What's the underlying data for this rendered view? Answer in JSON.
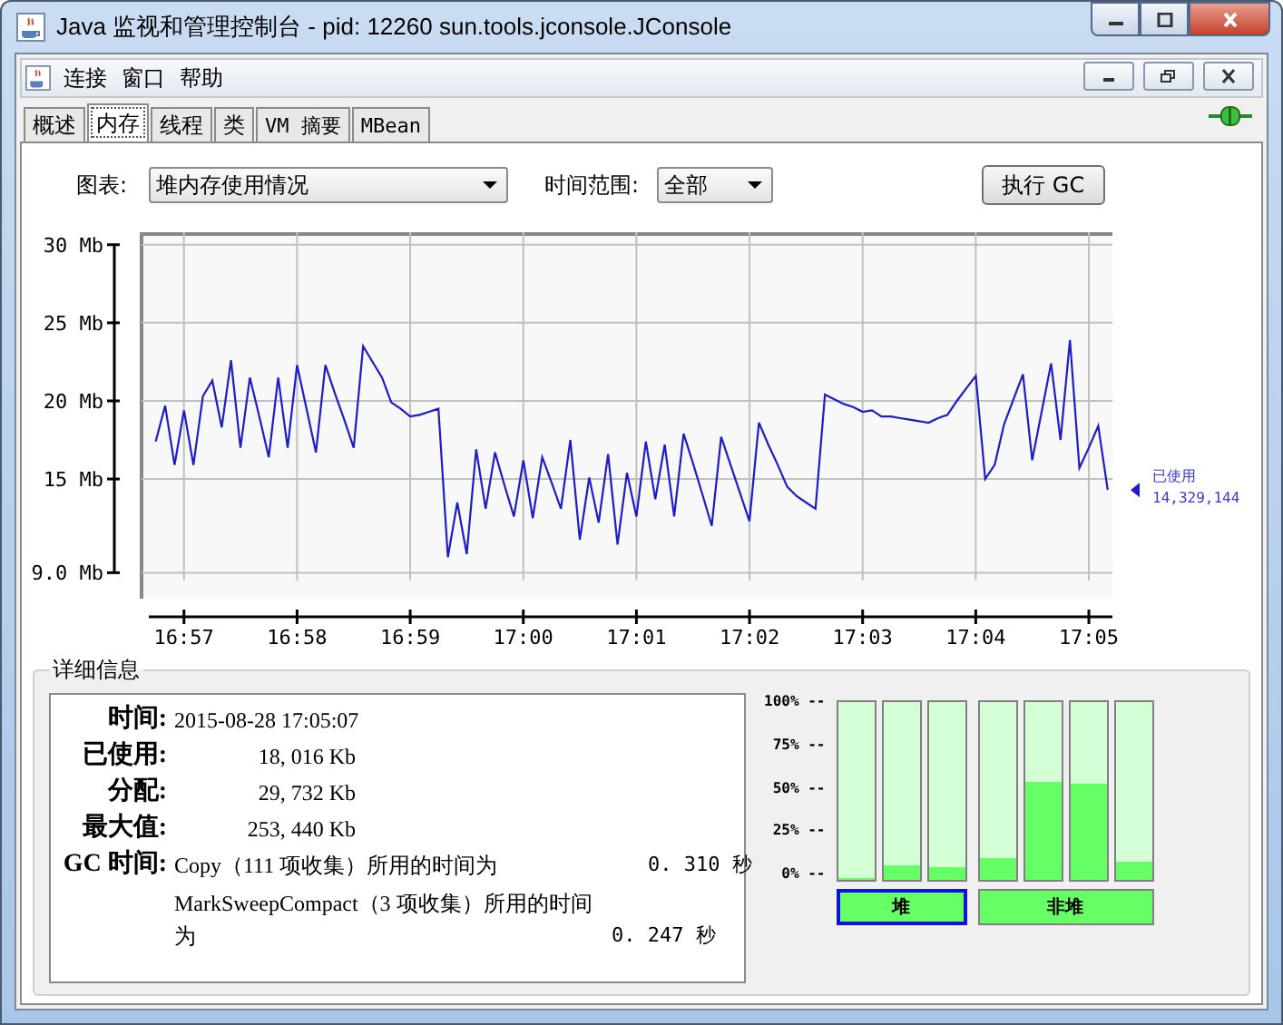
{
  "window": {
    "title": "Java 监视和管理控制台 - pid: 12260 sun.tools.jconsole.JConsole"
  },
  "menu": [
    "连接",
    "窗口",
    "帮助"
  ],
  "tabs": [
    {
      "label": "概述",
      "selected": false
    },
    {
      "label": "内存",
      "selected": true
    },
    {
      "label": "线程",
      "selected": false
    },
    {
      "label": "类",
      "selected": false
    },
    {
      "label": "VM 摘要",
      "selected": false
    },
    {
      "label": "MBean",
      "selected": false
    }
  ],
  "controls": {
    "chart_label": "图表:",
    "chart_select": "堆内存使用情况",
    "range_label": "时间范围:",
    "range_select": "全部",
    "gc_button": "执行 GC"
  },
  "chart": {
    "legend": {
      "value": "14,329,144"
    },
    "chart_data": {
      "type": "line",
      "categories": [
        null,
        null,
        null,
        null,
        "16:57",
        null,
        null,
        null,
        null,
        null,
        null,
        null,
        null,
        null,
        null,
        null,
        "16:58",
        null,
        null,
        null,
        null,
        null,
        null,
        null,
        null,
        null,
        null,
        null,
        "16:59",
        null,
        null,
        null,
        null,
        null,
        null,
        null,
        null,
        null,
        null,
        null,
        "17:00",
        null,
        null,
        null,
        null,
        null,
        null,
        null,
        null,
        null,
        null,
        null,
        "17:01",
        null,
        null,
        null,
        null,
        null,
        null,
        null,
        null,
        null,
        null,
        null,
        "17:02",
        null,
        null,
        null,
        null,
        null,
        null,
        null,
        null,
        null,
        null,
        null,
        "17:03",
        null,
        null,
        null,
        null,
        null,
        null,
        null,
        null,
        null,
        null,
        null,
        "17:04",
        null,
        null,
        null,
        null,
        null,
        null,
        null,
        null,
        null,
        null,
        null,
        "17:05",
        null,
        null
      ],
      "series": [
        {
          "name": "已使用",
          "color": "#1c1cc8",
          "values": [
            null,
            17.4,
            19.7,
            15.9,
            19.4,
            15.9,
            20.3,
            21.3,
            18.3,
            22.6,
            17.0,
            21.5,
            19.0,
            16.4,
            21.5,
            17.0,
            22.3,
            19.5,
            16.7,
            22.3,
            20.5,
            18.8,
            17.0,
            23.5,
            22.5,
            21.5,
            19.9,
            19.5,
            19.0,
            19.1,
            19.3,
            19.5,
            10.0,
            13.5,
            10.2,
            16.9,
            13.1,
            16.7,
            14.6,
            12.6,
            16.2,
            12.5,
            16.4,
            14.8,
            13.1,
            17.5,
            11.1,
            15.1,
            12.2,
            16.6,
            10.8,
            15.4,
            12.6,
            17.4,
            13.7,
            17.2,
            12.6,
            17.9,
            16.0,
            14.0,
            12.0,
            17.7,
            15.9,
            14.1,
            12.3,
            18.6,
            17.2,
            15.9,
            14.5,
            13.9,
            13.5,
            13.1,
            20.4,
            20.1,
            19.8,
            19.6,
            19.3,
            19.4,
            19.0,
            19.0,
            18.9,
            18.8,
            18.7,
            18.6,
            18.9,
            19.1,
            20.0,
            20.8,
            21.6,
            15.0,
            15.9,
            18.5,
            20.1,
            21.7,
            16.2,
            19.3,
            22.4,
            17.5,
            23.9,
            15.7,
            17.0,
            18.4,
            14.3
          ]
        }
      ],
      "ylim": [
        8.5,
        30.8
      ],
      "grid": true,
      "yticks": [
        {
          "value": 9,
          "label": "9.0 Mb"
        },
        {
          "value": 15,
          "label": "15 Mb"
        },
        {
          "value": 20,
          "label": "20 Mb"
        },
        {
          "value": 25,
          "label": "25 Mb"
        },
        {
          "value": 30,
          "label": "30 Mb"
        }
      ]
    }
  },
  "details": {
    "title": "详细信息",
    "rows": [
      {
        "kind": "text",
        "label": "时间:",
        "value": "2015-08-28 17:05:07"
      },
      {
        "kind": "amount",
        "label": "已使用:",
        "value": "18, 016 Kb"
      },
      {
        "kind": "amount",
        "label": "分配:",
        "value": "29, 732 Kb"
      },
      {
        "kind": "amount",
        "label": "最大值:",
        "value": "253, 440 Kb"
      }
    ],
    "gc": {
      "label": "GC 时间:",
      "entries": [
        {
          "text": "Copy（111 项收集）所用的时间为",
          "time": "0. 310 秒"
        },
        {
          "text": "MarkSweepCompact（3 项收集）所用的时间为",
          "time": "0. 247 秒"
        }
      ]
    }
  },
  "pools": {
    "ticks": [
      "100% --",
      "75% --",
      "50% --",
      "25% --",
      "0% --"
    ],
    "groups": [
      {
        "label": "堆",
        "selected": true,
        "bars": [
          {
            "level": 0.01
          },
          {
            "level": 0.08
          },
          {
            "level": 0.07
          }
        ]
      },
      {
        "label": "非堆",
        "selected": false,
        "bars": [
          {
            "level": 0.12
          },
          {
            "level": 0.55
          },
          {
            "level": 0.54
          },
          {
            "level": 0.1
          }
        ]
      }
    ]
  }
}
